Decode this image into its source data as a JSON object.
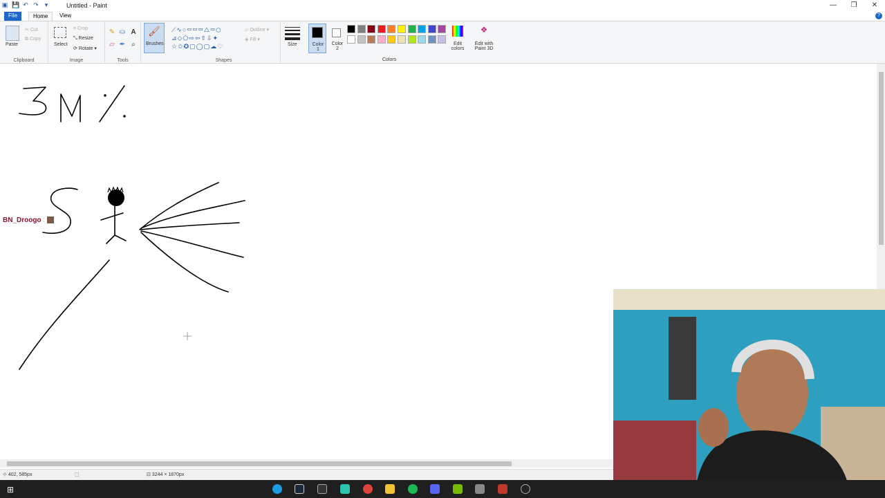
{
  "window": {
    "title": "Untitled - Paint"
  },
  "tabs": [
    "File",
    "Home",
    "View"
  ],
  "ribbon": {
    "clipboard": {
      "paste": "Paste",
      "cut": "Cut",
      "copy": "Copy",
      "label": "Clipboard"
    },
    "image": {
      "select": "Select",
      "crop": "Crop",
      "resize": "Resize",
      "rotate": "Rotate",
      "label": "Image"
    },
    "tools": {
      "label": "Tools"
    },
    "brushes": {
      "label": "Brushes"
    },
    "shapes": {
      "outline": "Outline",
      "fill": "Fill",
      "label": "Shapes"
    },
    "size": {
      "label": "Size"
    },
    "color1": {
      "label": "Color 1"
    },
    "color2": {
      "label": "Color 2"
    },
    "colors": {
      "label": "Colors",
      "edit": "Edit colors",
      "paint3d": "Edit with Paint 3D",
      "palette_row1": [
        "#000000",
        "#7f7f7f",
        "#880015",
        "#ed1c24",
        "#ff7f27",
        "#fff200",
        "#22b14c",
        "#00a2e8",
        "#3f48cc",
        "#a349a4"
      ],
      "palette_row2": [
        "#ffffff",
        "#c3c3c3",
        "#b97a57",
        "#ffaec9",
        "#ffc90e",
        "#efe4b0",
        "#b5e61d",
        "#99d9ea",
        "#7092be",
        "#c8bfe7"
      ]
    }
  },
  "canvas": {
    "comment_user": "BN_Droogo",
    "comment_sep": ":"
  },
  "status": {
    "cursor": "402, 585px",
    "size": "3244 × 1870px"
  },
  "colors": {
    "accent": "#1e66c8",
    "comment": "#8b1630"
  }
}
